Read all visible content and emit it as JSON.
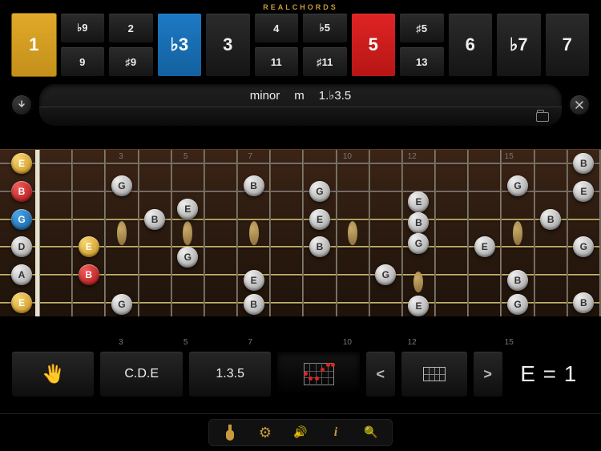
{
  "app_title": "REALCHORDS",
  "colors": {
    "gold": "#c89021",
    "blue": "#155d9c",
    "red": "#b71515",
    "grey": "#9a9a9a"
  },
  "interval_cols": [
    {
      "cells": [
        {
          "label": "1",
          "sel": "gold",
          "tall": true
        }
      ]
    },
    {
      "cells": [
        {
          "label": "♭9"
        },
        {
          "label": "9"
        }
      ]
    },
    {
      "cells": [
        {
          "label": "2"
        },
        {
          "label": "♯9"
        }
      ]
    },
    {
      "cells": [
        {
          "label": "♭3",
          "sel": "blue",
          "tall": true
        }
      ]
    },
    {
      "cells": [
        {
          "label": "3",
          "tall": true
        }
      ]
    },
    {
      "cells": [
        {
          "label": "4"
        },
        {
          "label": "11"
        }
      ]
    },
    {
      "cells": [
        {
          "label": "♭5"
        },
        {
          "label": "♯11"
        }
      ]
    },
    {
      "cells": [
        {
          "label": "5",
          "sel": "red",
          "tall": true
        }
      ]
    },
    {
      "cells": [
        {
          "label": "♯5"
        },
        {
          "label": "13"
        }
      ]
    },
    {
      "cells": [
        {
          "label": "6",
          "tall": true
        }
      ]
    },
    {
      "cells": [
        {
          "label": "♭7",
          "tall": true
        }
      ]
    },
    {
      "cells": [
        {
          "label": "7",
          "tall": true
        }
      ]
    }
  ],
  "chord": {
    "name": "minor",
    "symbol": "m",
    "formula": "1.♭3.5"
  },
  "fret_numbers_top": [
    "",
    "",
    "3",
    "",
    "5",
    "",
    "7",
    "",
    "",
    "10",
    "",
    "12",
    "",
    "",
    "15",
    "",
    ""
  ],
  "tuning": [
    {
      "note": "E",
      "color": "gold"
    },
    {
      "note": "B",
      "color": "red"
    },
    {
      "note": "G",
      "color": "blue"
    },
    {
      "note": "D",
      "color": "grey"
    },
    {
      "note": "A",
      "color": "grey"
    },
    {
      "note": "E",
      "color": "gold"
    }
  ],
  "fretboard": [
    [
      "",
      "",
      "G",
      "",
      "",
      "",
      "B",
      "",
      "",
      "",
      "",
      "E",
      "",
      "",
      "G",
      "",
      "B"
    ],
    [
      "",
      "",
      "",
      "",
      "E",
      "",
      "",
      "",
      "G",
      "",
      "",
      "B",
      "",
      "",
      "",
      "",
      "E"
    ],
    [
      "",
      "",
      "",
      "B",
      "",
      "",
      "",
      "",
      "E",
      "",
      "",
      "G",
      "",
      "",
      "",
      "B",
      ""
    ],
    [
      "",
      "E",
      "",
      "",
      "G",
      "",
      "",
      "",
      "B",
      "",
      "",
      "",
      "",
      "E",
      "",
      "",
      "G"
    ],
    [
      "",
      "B",
      "",
      "",
      "",
      "",
      "E",
      "",
      "",
      "",
      "G",
      "",
      "",
      "",
      "B",
      "",
      ""
    ],
    [
      "",
      "",
      "G",
      "",
      "",
      "",
      "B",
      "",
      "",
      "",
      "",
      "E",
      "",
      "",
      "G",
      "",
      "B"
    ]
  ],
  "note_color": {
    "E": "gold",
    "G": "blue",
    "B": "red"
  },
  "fret_numbers_bottom": [
    "",
    "",
    "3",
    "",
    "5",
    "",
    "7",
    "",
    "",
    "10",
    "",
    "12",
    "",
    "",
    "15",
    "",
    ""
  ],
  "toolbar": {
    "hand_label": "✋",
    "notes_label": "C.D.E",
    "intervals_label": "1.3.5",
    "prev": "<",
    "next": ">"
  },
  "readout": "E = 1"
}
